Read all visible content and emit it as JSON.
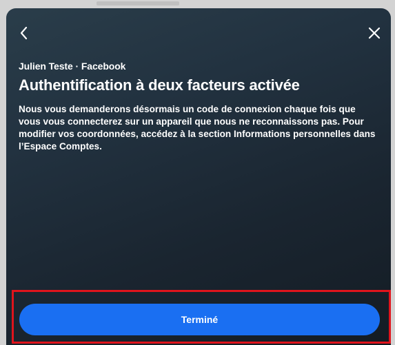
{
  "account_line": "Julien Teste · Facebook",
  "title": "Authentification à deux facteurs activée",
  "body": "Nous vous demanderons désormais un code de connexion chaque fois que vous vous connecterez sur un appareil que nous ne reconnaissons pas. Pour modifier vos coordonnées, accédez à la section Informations personnelles dans l’Espace Comptes.",
  "buttons": {
    "done_label": "Terminé"
  },
  "icons": {
    "back": "chevron-left-icon",
    "close": "close-icon"
  },
  "colors": {
    "primary_button": "#1a6ff2",
    "highlight_outline": "#e0141c",
    "modal_background": "#1e2b36",
    "text": "#ffffff"
  }
}
